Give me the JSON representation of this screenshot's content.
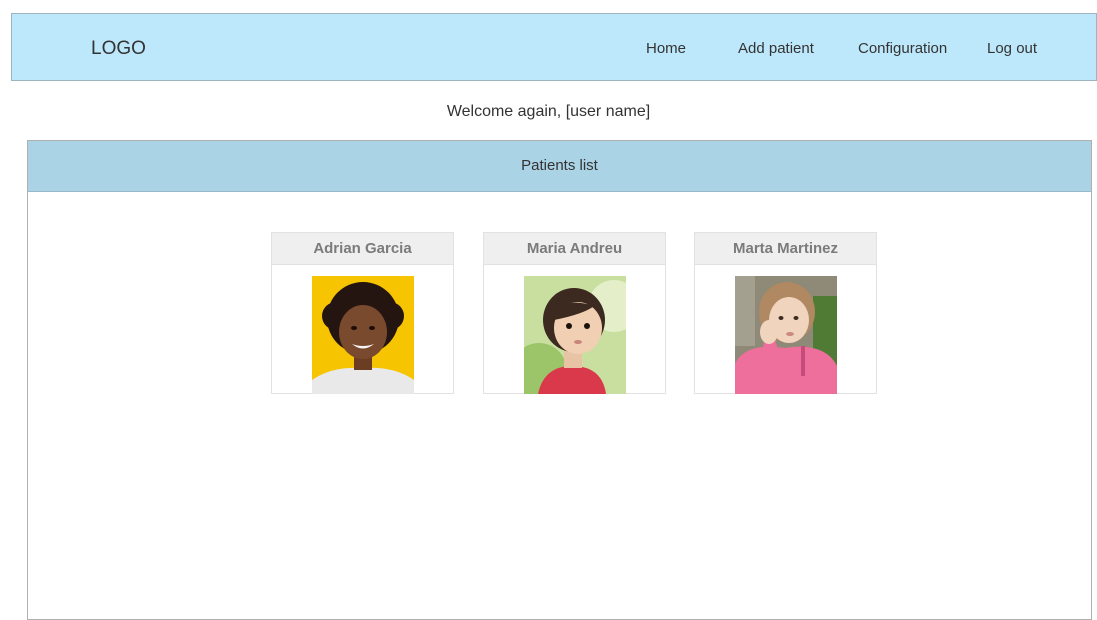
{
  "header": {
    "logo": "LOGO",
    "nav": [
      {
        "label": "Home"
      },
      {
        "label": "Add patient"
      },
      {
        "label": "Configuration"
      },
      {
        "label": "Log out"
      }
    ]
  },
  "welcome": "Welcome again, [user name]",
  "patients_panel": {
    "title": "Patients list",
    "patients": [
      {
        "name": "Adrian Garcia",
        "photo": "child-photo-yellow-background"
      },
      {
        "name": "Maria Andreu",
        "photo": "toddler-photo-green-background"
      },
      {
        "name": "Marta Martinez",
        "photo": "girl-pink-jacket-photo"
      }
    ]
  },
  "colors": {
    "header_bg": "#bde8fb",
    "panel_header_bg": "#abd3e6",
    "card_header_bg": "#efefef"
  }
}
